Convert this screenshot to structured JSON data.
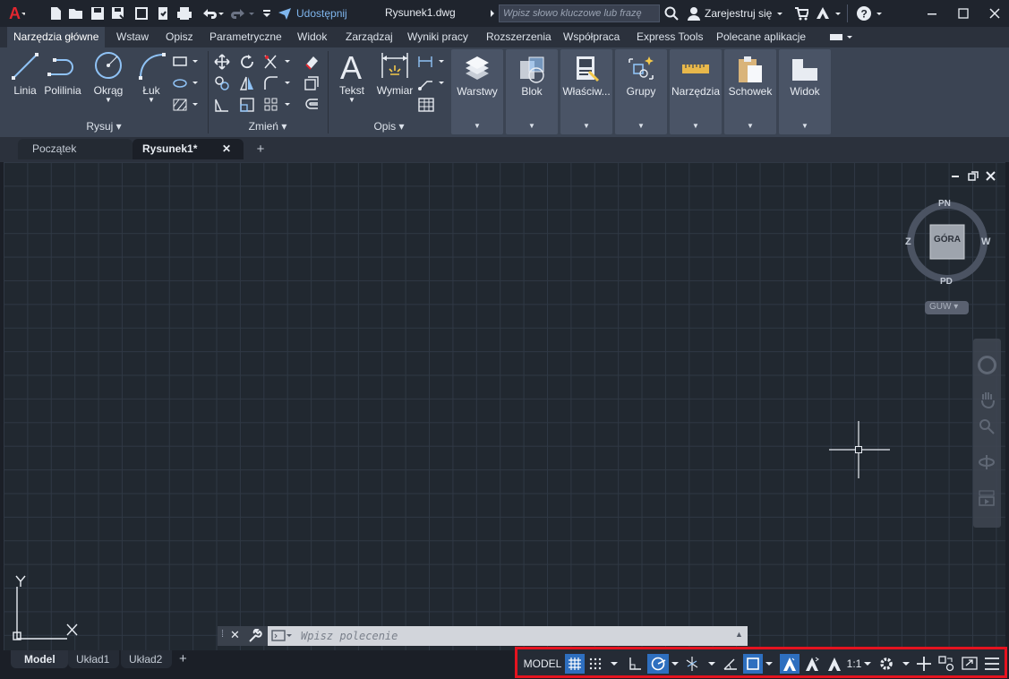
{
  "titlebar": {
    "share_label": "Udostępnij",
    "document_title": "Rysunek1.dwg",
    "search_placeholder": "Wpisz słowo kluczowe lub frazę",
    "signin_label": "Zarejestruj się"
  },
  "ribbon_tabs": [
    "Narzędzia główne",
    "Wstaw",
    "Opisz",
    "Parametryczne",
    "Widok",
    "Zarządzaj",
    "Wyniki pracy",
    "Rozszerzenia",
    "Współpraca",
    "Express Tools",
    "Polecane aplikacje"
  ],
  "ribbon": {
    "draw": {
      "title": "Rysuj",
      "line": "Linia",
      "polyline": "Polilinia",
      "circle": "Okrąg",
      "arc": "Łuk"
    },
    "modify": {
      "title": "Zmień"
    },
    "annotation": {
      "title": "Opis",
      "text": "Tekst",
      "dimension": "Wymiar"
    },
    "groups": [
      "Warstwy",
      "Blok",
      "Właściw...",
      "Grupy",
      "Narzędzia",
      "Schowek",
      "Widok"
    ]
  },
  "file_tabs": {
    "start": "Początek",
    "drawing": "Rysunek1*"
  },
  "viewcube": {
    "north": "PN",
    "south": "PD",
    "west": "Z",
    "east": "W",
    "face": "GÓRA",
    "ucs": "GUW"
  },
  "command": {
    "placeholder": "Wpisz polecenie"
  },
  "layout_tabs": [
    "Model",
    "Układ1",
    "Układ2"
  ],
  "statusbar": {
    "model": "MODEL",
    "scale": "1:1"
  },
  "colors": {
    "accent": "#2e6fbf",
    "highlight_border": "#e5131f",
    "canvas": "#212830",
    "grid": "#2f3844"
  }
}
